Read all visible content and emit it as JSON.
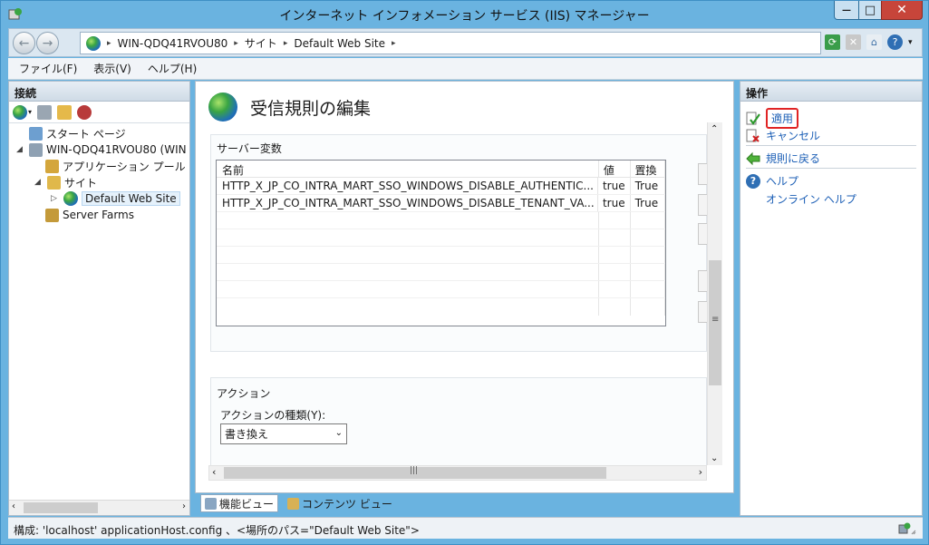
{
  "window": {
    "title": "インターネット インフォメーション サービス (IIS) マネージャー",
    "close_glyph": "✕",
    "max_glyph": "□",
    "min_glyph": "—"
  },
  "address": {
    "crumbs": [
      "WIN-QDQ41RVOU80",
      "サイト",
      "Default Web Site"
    ],
    "separator": "▸"
  },
  "menu": {
    "items": [
      "ファイル(F)",
      "表示(V)",
      "ヘルプ(H)"
    ]
  },
  "connections": {
    "header": "接続",
    "tree": [
      {
        "label": "スタート ページ",
        "icon": "start-page-icon"
      },
      {
        "label": "WIN-QDQ41RVOU80 (WIN",
        "icon": "server-icon"
      },
      {
        "label": "アプリケーション プール",
        "icon": "app-pool-icon"
      },
      {
        "label": "サイト",
        "icon": "sites-folder-icon"
      },
      {
        "label": "Default Web Site",
        "icon": "globe-icon"
      },
      {
        "label": "Server Farms",
        "icon": "server-farms-icon"
      }
    ]
  },
  "main": {
    "title": "受信規則の編集",
    "server_vars": {
      "label": "サーバー変数",
      "columns": {
        "name": "名前",
        "value": "値",
        "replace": "置換"
      },
      "rows": [
        {
          "name": "HTTP_X_JP_CO_INTRA_MART_SSO_WINDOWS_DISABLE_AUTHENTIC...",
          "value": "true",
          "replace": "True"
        },
        {
          "name": "HTTP_X_JP_CO_INTRA_MART_SSO_WINDOWS_DISABLE_TENANT_VA...",
          "value": "true",
          "replace": "True"
        }
      ]
    },
    "actions": {
      "label": "アクション",
      "type_label": "アクションの種類(Y):",
      "type_value": "書き換え"
    }
  },
  "view_tabs": {
    "features": "機能ビュー",
    "content": "コンテンツ ビュー"
  },
  "operations": {
    "header": "操作",
    "apply": "適用",
    "cancel": "キャンセル",
    "back_to_rules": "規則に戻る",
    "help": "ヘルプ",
    "online_help": "オンライン ヘルプ"
  },
  "status": {
    "text": "構成: 'localhost' applicationHost.config 、<場所のパス=\"Default Web Site\">"
  },
  "colors": {
    "link": "#1c5fb6",
    "highlight": "#e02424",
    "chrome": "#6ab3e0"
  }
}
